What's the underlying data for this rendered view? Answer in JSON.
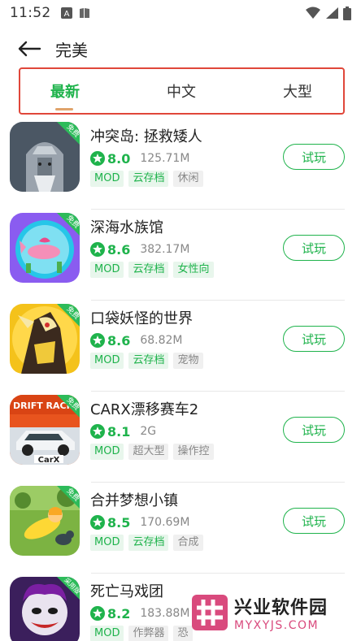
{
  "status_bar": {
    "time": "11:52",
    "left_icons": [
      "notification-a-icon",
      "book-icon"
    ],
    "right_icons": [
      "wifi-icon",
      "signal-icon",
      "battery-icon"
    ]
  },
  "header": {
    "title": "完美",
    "back_icon": "arrow-left-icon"
  },
  "tabs": [
    {
      "label": "最新",
      "active": true
    },
    {
      "label": "中文",
      "active": false
    },
    {
      "label": "大型",
      "active": false
    }
  ],
  "colors": {
    "accent": "#1fb34c",
    "tab_highlight_border": "#e0473a",
    "free_badge": "#2dbb5a"
  },
  "games": [
    {
      "name": "冲突岛: 拯救矮人",
      "rating": "8.0",
      "size": "125.71M",
      "badge": "免费",
      "tags": [
        {
          "text": "MOD",
          "style": "green"
        },
        {
          "text": "云存档",
          "style": "green"
        },
        {
          "text": "休闲",
          "style": "gray"
        }
      ],
      "button": "试玩"
    },
    {
      "name": "深海水族馆",
      "rating": "8.6",
      "size": "382.17M",
      "badge": "免费",
      "tags": [
        {
          "text": "MOD",
          "style": "green"
        },
        {
          "text": "云存档",
          "style": "green"
        },
        {
          "text": "女性向",
          "style": "green"
        }
      ],
      "button": "试玩"
    },
    {
      "name": "口袋妖怪的世界",
      "rating": "8.6",
      "size": "68.82M",
      "badge": "免费",
      "tags": [
        {
          "text": "MOD",
          "style": "green"
        },
        {
          "text": "云存档",
          "style": "green"
        },
        {
          "text": "宠物",
          "style": "gray"
        }
      ],
      "button": "试玩"
    },
    {
      "name": "CARX漂移赛车2",
      "rating": "8.1",
      "size": "2G",
      "badge": "免费",
      "tags": [
        {
          "text": "MOD",
          "style": "green"
        },
        {
          "text": "超大型",
          "style": "gray"
        },
        {
          "text": "操作控",
          "style": "gray"
        }
      ],
      "button": "试玩"
    },
    {
      "name": "合并梦想小镇",
      "rating": "8.5",
      "size": "170.69M",
      "badge": "免费",
      "tags": [
        {
          "text": "MOD",
          "style": "green"
        },
        {
          "text": "云存档",
          "style": "green"
        },
        {
          "text": "合成",
          "style": "gray"
        }
      ],
      "button": "试玩"
    },
    {
      "name": "死亡马戏团",
      "rating": "8.2",
      "size": "183.88M",
      "badge": "采用版",
      "tags": [
        {
          "text": "MOD",
          "style": "green"
        },
        {
          "text": "作弊器",
          "style": "gray"
        },
        {
          "text": "恐",
          "style": "gray"
        }
      ],
      "button": ""
    }
  ],
  "watermark": {
    "name": "兴业软件园",
    "url": "MYXYJS.COM"
  }
}
